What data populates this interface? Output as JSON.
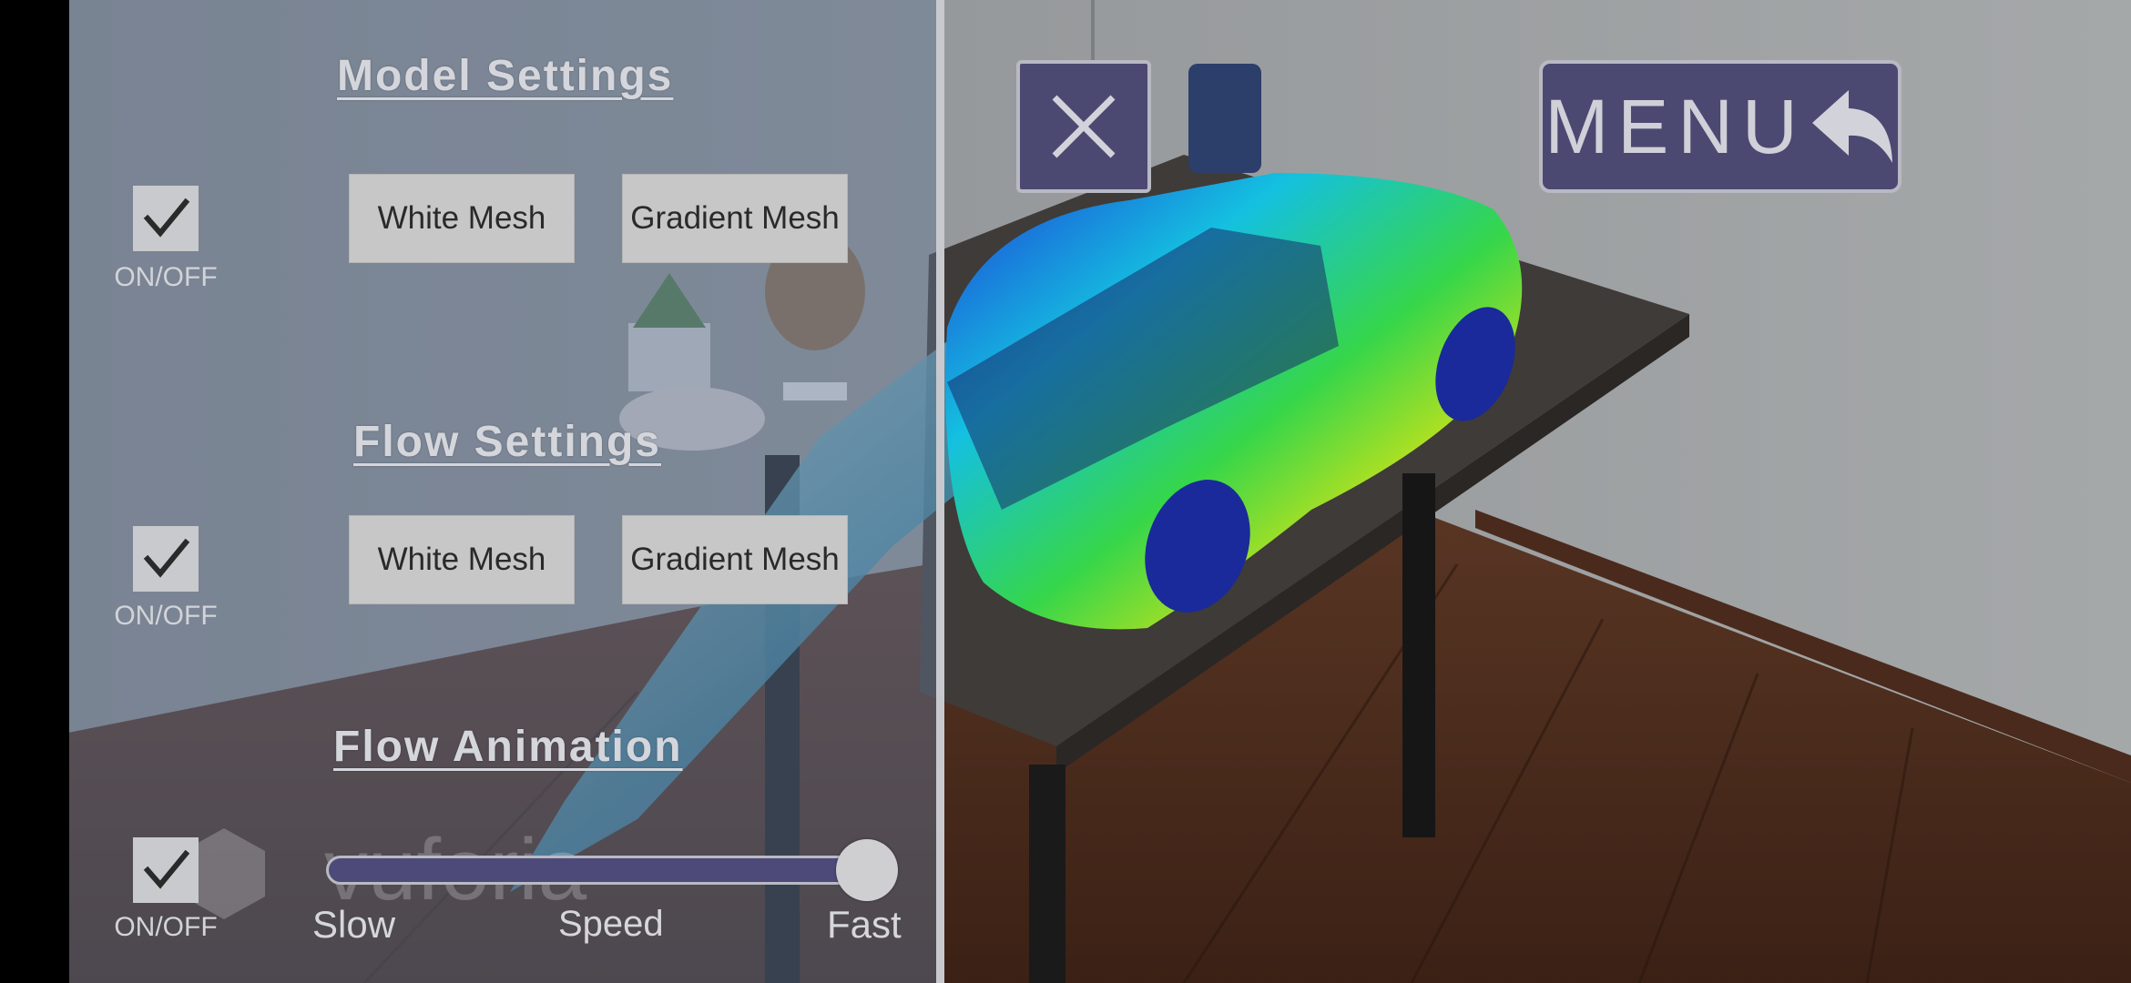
{
  "model_settings": {
    "title": "Model Settings",
    "toggle_label": "ON/OFF",
    "buttons": {
      "white_mesh": "White Mesh",
      "gradient_mesh": "Gradient Mesh"
    }
  },
  "flow_settings": {
    "title": "Flow Settings",
    "toggle_label": "ON/OFF",
    "buttons": {
      "white_mesh": "White Mesh",
      "gradient_mesh": "Gradient Mesh"
    }
  },
  "flow_animation": {
    "title": "Flow Animation",
    "toggle_label": "ON/OFF",
    "slider": {
      "min_label": "Slow",
      "center_label": "Speed",
      "max_label": "Fast",
      "value": 1.0
    }
  },
  "header": {
    "menu_label": "MENU",
    "close_icon": "close-icon",
    "menu_icon": "reply-arrow-icon"
  },
  "watermark": {
    "text": "vuforia"
  },
  "colors": {
    "button_accent": "#4b4872",
    "checkbox": "#c9cacd"
  }
}
